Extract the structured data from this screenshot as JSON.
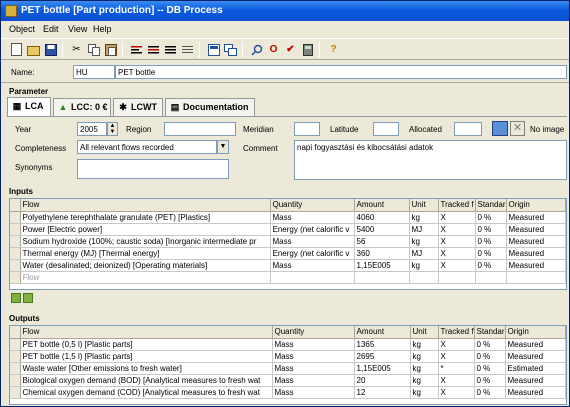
{
  "window": {
    "title": "PET bottle [Part production] -- DB Process"
  },
  "menu": [
    "Object",
    "Edit",
    "View",
    "Help"
  ],
  "toolbar_icons": [
    "new-document-icon",
    "open-icon",
    "save-icon",
    "cut-icon",
    "copy-icon",
    "paste-icon",
    "align-left-icon",
    "align-center-icon",
    "align-right-icon",
    "justify-icon",
    "preview-icon",
    "windows-icon",
    "search-icon",
    "o-icon",
    "check-icon",
    "calculator-icon",
    "help-icon"
  ],
  "name_row": {
    "label": "Name:",
    "language": "HU",
    "value": "PET bottle"
  },
  "parameter": {
    "label": "Parameter",
    "tabs": [
      {
        "label": "LCA",
        "icon": "chart-icon"
      },
      {
        "label": "LCC: 0 €",
        "icon": "money-icon"
      },
      {
        "label": "LCWT",
        "icon": "worker-icon"
      },
      {
        "label": "Documentation",
        "icon": "document-icon"
      }
    ],
    "year_label": "Year",
    "year_value": "2005",
    "region_label": "Region",
    "region_value": "",
    "meridian_label": "Meridian",
    "latitude_label": "Latitude",
    "allocated_label": "Allocated",
    "no_image_label": "No image",
    "completeness_label": "Completeness",
    "completeness_value": "All relevant flows recorded",
    "comment_label": "Comment",
    "comment_value": "napi fogyasztási és kibocsátási adatok",
    "synonyms_label": "Synonyms"
  },
  "inputs": {
    "label": "Inputs",
    "columns": [
      "Flow",
      "Quantity",
      "Amount",
      "Unit",
      "Tracked f",
      "Standar",
      "Origin"
    ],
    "rows": [
      [
        "Polyethylene terephthalate granulate (PET) [Plastics]",
        "Mass",
        "4060",
        "kg",
        "X",
        "0 %",
        "Measured"
      ],
      [
        "Power [Electric power]",
        "Energy (net calorific v",
        "5400",
        "MJ",
        "X",
        "0 %",
        "Measured"
      ],
      [
        "Sodium hydroxide (100%; caustic soda) [Inorganic intermediate pr",
        "Mass",
        "56",
        "kg",
        "X",
        "0 %",
        "Measured"
      ],
      [
        "Thermal energy (MJ) [Thermal energy]",
        "Energy (net calorific v",
        "360",
        "MJ",
        "X",
        "0 %",
        "Measured"
      ],
      [
        "Water (desalinated; deionized) [Operating materials]",
        "Mass",
        "1,15E005",
        "kg",
        "X",
        "0 %",
        "Measured"
      ]
    ],
    "new_row_placeholder": "Flow"
  },
  "outputs": {
    "label": "Outputs",
    "columns": [
      "Flow",
      "Quantity",
      "Amount",
      "Unit",
      "Tracked f",
      "Standar",
      "Origin"
    ],
    "rows": [
      [
        "PET bottle (0,5 l) [Plastic parts]",
        "Mass",
        "1365",
        "kg",
        "X",
        "0 %",
        "Measured"
      ],
      [
        "PET bottle (1,5 l) [Plastic parts]",
        "Mass",
        "2695",
        "kg",
        "X",
        "0 %",
        "Measured"
      ],
      [
        "Waste water [Other emissions to fresh water]",
        "Mass",
        "1,15E005",
        "kg",
        "*",
        "0 %",
        "Estimated"
      ],
      [
        "Biological oxygen demand (BOD) [Analytical measures to fresh wat",
        "Mass",
        "20",
        "kg",
        "X",
        "0 %",
        "Measured"
      ],
      [
        "Chemical oxygen demand (COD) [Analytical measures to fresh wat",
        "Mass",
        "12",
        "kg",
        "X",
        "0 %",
        "Measured"
      ]
    ]
  },
  "colors": {
    "titlebar": "#0b5ce0",
    "background": "#ece9d8"
  }
}
